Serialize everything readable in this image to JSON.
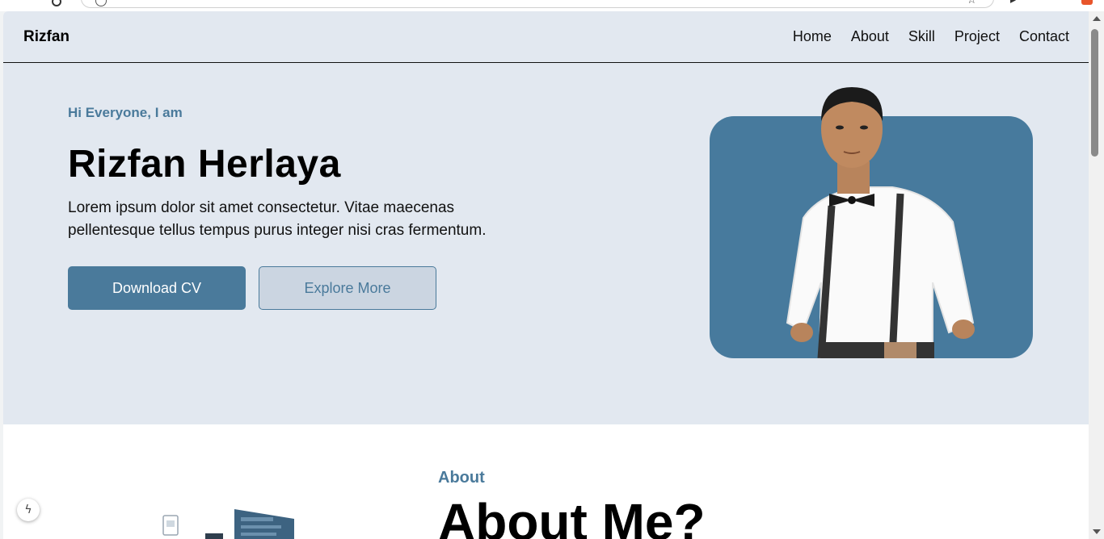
{
  "navbar": {
    "brand": "Rizfan",
    "links": [
      "Home",
      "About",
      "Skill",
      "Project",
      "Contact"
    ]
  },
  "hero": {
    "greeting": "Hi Everyone, I am",
    "name": "Rizfan Herlaya",
    "description": "Lorem ipsum dolor sit amet consectetur. Vitae maecenas pellentesque tellus tempus purus integer nisi cras fermentum.",
    "primary_button": "Download CV",
    "secondary_button": "Explore More"
  },
  "about": {
    "kicker": "About",
    "title": "About Me?"
  },
  "colors": {
    "accent": "#4a7a9b",
    "hero_bg": "#e2e8f0",
    "card_bg": "#477a9d"
  },
  "icons": {
    "fab": "lightning-icon"
  }
}
